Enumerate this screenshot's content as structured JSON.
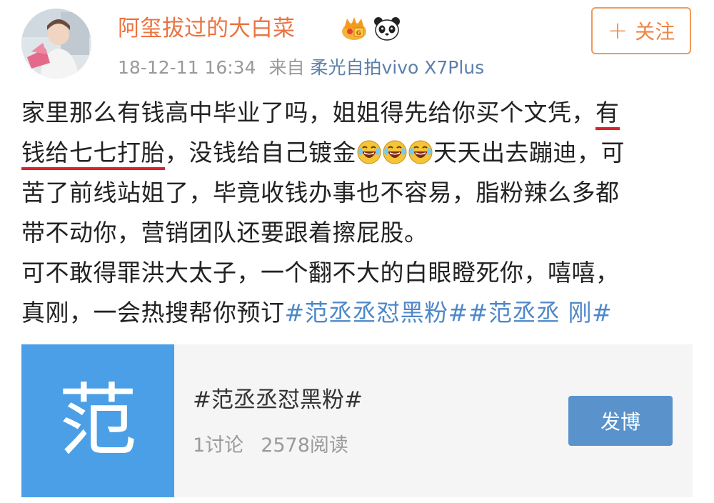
{
  "header": {
    "username": "阿玺拔过的大白菜",
    "badges": [
      "crown-badge-icon",
      "panda-icon"
    ],
    "timestamp": "18-12-11 16:34",
    "source_prefix": "来自",
    "source_device": "柔光自拍vivo X7Plus",
    "follow_plus": "+",
    "follow_label": "关注"
  },
  "post": {
    "line1_a": "家里那么有钱高中毕业了吗，姐姐得先给你买个文凭，",
    "line1_b": "有",
    "line2_a": "钱给七七打胎",
    "line2_b": "，没钱给自己镀金",
    "line2_c": "天天出去蹦迪，可",
    "line3": "苦了前线站姐了，毕竟收钱办事也不容易，脂粉辣么多都",
    "line4": "带不动你，营销团队还要跟着擦屁股。",
    "line5": "可不敢得罪洪大太子，一个翻不大的白眼瞪死你，嘻嘻，",
    "line6_a": "真刚，一会热搜帮你预订",
    "line6_tags": "#范丞丞怼黑粉##范丞丞 刚#",
    "emoji_name": "laughing-tears-emoji",
    "emoji_count": 3,
    "colors": {
      "underline": "#d8232a",
      "hashtag": "#4f88c8"
    }
  },
  "card": {
    "thumb_char": "范",
    "title": "#范丞丞怼黑粉#",
    "discussions": "1讨论",
    "reads": "2578阅读",
    "post_button": "发博",
    "colors": {
      "thumb": "#4a9fe6",
      "button": "#5a93cc"
    }
  },
  "colors": {
    "username": "#eb7340",
    "source": "#5b7fab",
    "follow": "#ee8645"
  }
}
